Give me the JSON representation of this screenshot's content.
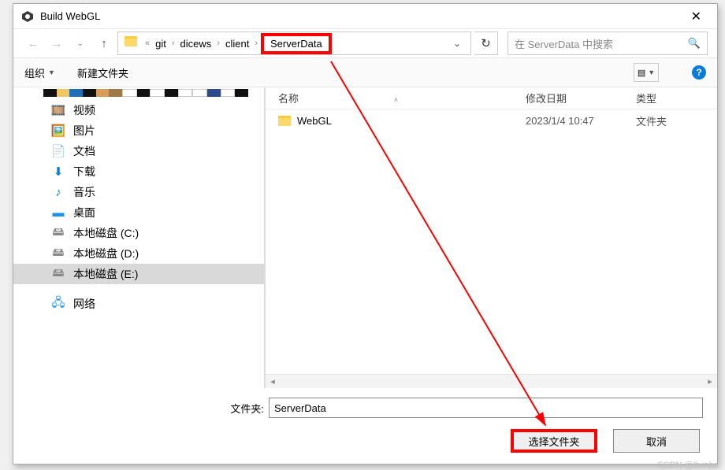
{
  "window": {
    "title": "Build WebGL"
  },
  "breadcrumb": {
    "p0": "git",
    "p1": "dicews",
    "p2": "client",
    "p3": "ServerData"
  },
  "search": {
    "placeholder": "在 ServerData 中搜索"
  },
  "toolbar": {
    "organize": "组织",
    "newfolder": "新建文件夹"
  },
  "columns": {
    "name": "名称",
    "modified": "修改日期",
    "type": "类型"
  },
  "files": [
    {
      "name": "WebGL",
      "modified": "2023/1/4 10:47",
      "type": "文件夹"
    }
  ],
  "sidebar": {
    "video": "视频",
    "pictures": "图片",
    "documents": "文档",
    "downloads": "下载",
    "music": "音乐",
    "desktop": "桌面",
    "drive_c": "本地磁盘 (C:)",
    "drive_d": "本地磁盘 (D:)",
    "drive_e": "本地磁盘 (E:)",
    "network": "网络"
  },
  "footer": {
    "folder_label": "文件夹:",
    "folder_value": "ServerData",
    "select_btn": "选择文件夹",
    "cancel_btn": "取消"
  },
  "watermark": "CSDN @lbxnba"
}
